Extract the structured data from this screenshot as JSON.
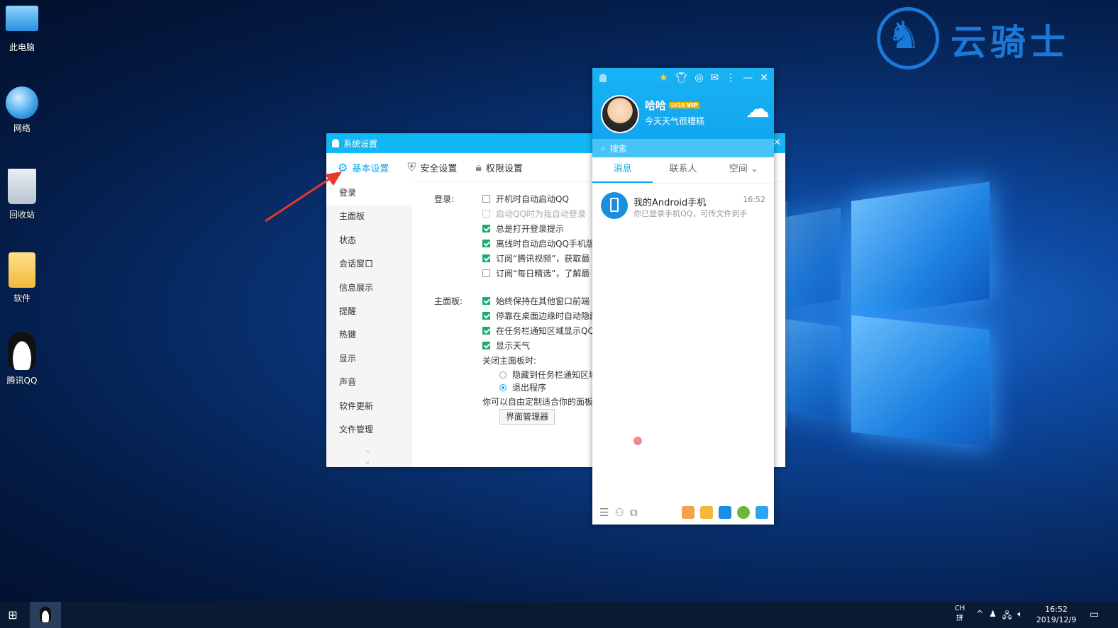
{
  "brand": {
    "text": "云骑士"
  },
  "desktop_icons": [
    {
      "label": "此电脑"
    },
    {
      "label": "网络"
    },
    {
      "label": "回收站"
    },
    {
      "label": "软件"
    },
    {
      "label": "腾讯QQ"
    }
  ],
  "settings": {
    "title": "系统设置",
    "close": "✕",
    "tabs": [
      {
        "label": "基本设置",
        "icon": "gear-icon"
      },
      {
        "label": "安全设置",
        "icon": "shield-icon"
      },
      {
        "label": "权限设置",
        "icon": "lock-icon"
      }
    ],
    "nav": [
      "登录",
      "主面板",
      "状态",
      "会话窗口",
      "信息展示",
      "提醒",
      "热键",
      "显示",
      "声音",
      "软件更新",
      "文件管理"
    ],
    "login_label": "登录:",
    "login_opts": [
      {
        "label": "开机时自动启动QQ",
        "checked": false,
        "disabled": false
      },
      {
        "label": "启动QQ时为我自动登录",
        "checked": false,
        "disabled": true
      },
      {
        "label": "总是打开登录提示",
        "checked": true,
        "disabled": false
      },
      {
        "label": "离线时自动启动QQ手机版(",
        "checked": true,
        "disabled": false
      },
      {
        "label": "订阅“腾讯视频”，获取最",
        "checked": true,
        "disabled": false
      },
      {
        "label": "订阅“每日精选”，了解最",
        "checked": false,
        "disabled": false
      }
    ],
    "panel_label": "主面板:",
    "panel_opts": [
      {
        "label": "始终保持在其他窗口前端",
        "checked": true
      },
      {
        "label": "停靠在桌面边缘时自动隐藏",
        "checked": true
      },
      {
        "label": "在任务栏通知区域显示QQ图",
        "checked": true
      },
      {
        "label": "显示天气",
        "checked": true
      }
    ],
    "close_panel_label": "关闭主面板时:",
    "radio_opts": [
      {
        "label": "隐藏到任务栏通知区域",
        "selected": false
      },
      {
        "label": "退出程序",
        "selected": true
      }
    ],
    "custom_text": "你可以自由定制适合你的面板和",
    "ui_manager_button": "界面管理器"
  },
  "qq": {
    "nickname": "哈哈",
    "level_badge": "LV18",
    "vip_badge": "VIP",
    "signature": "今天天气很糟糕",
    "search_placeholder": "搜索",
    "tabs": [
      "消息",
      "联系人",
      "空间"
    ],
    "messages": [
      {
        "name": "我的Android手机",
        "time": "16:52",
        "preview": "你已登录手机QQ，可传文件到手"
      }
    ],
    "colors": {
      "header": "#12b7f5",
      "accent": "#12a6e8"
    }
  },
  "taskbar": {
    "ime_top": "CH",
    "ime_bottom": "拼",
    "time": "16:52",
    "date": "2019/12/9"
  }
}
